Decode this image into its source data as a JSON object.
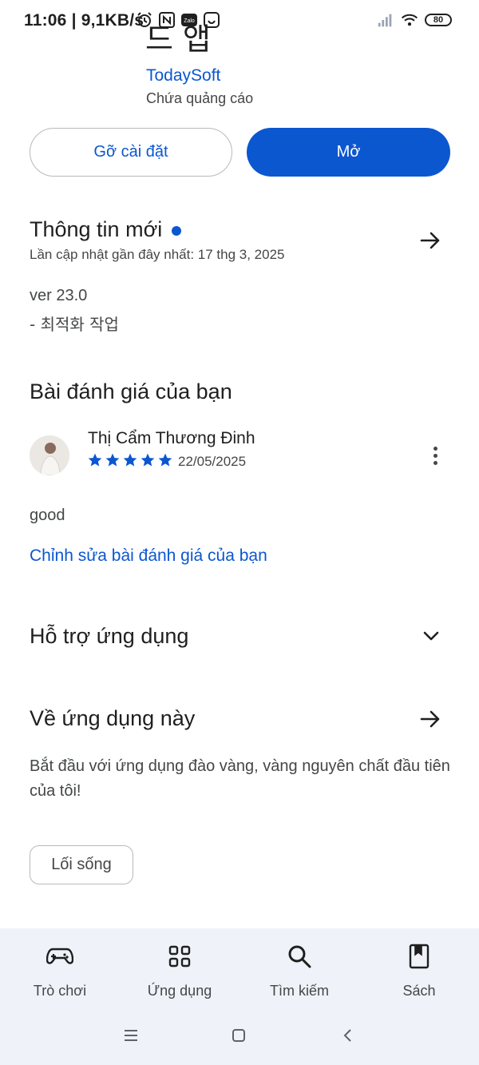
{
  "status_bar": {
    "time_speed": "11:06 | 9,1KB/s",
    "battery": "80",
    "icons": [
      "alarm-icon",
      "nfc-icon",
      "zalo-icon",
      "smiley-app-icon",
      "signal-icon",
      "wifi-icon",
      "battery-icon"
    ],
    "zalo_text": "Zalo"
  },
  "app": {
    "name_partial": "드 앱",
    "developer": "TodaySoft",
    "ads_note": "Chứa quảng cáo"
  },
  "actions": {
    "uninstall_label": "Gỡ cài đặt",
    "open_label": "Mở"
  },
  "whats_new": {
    "title": "Thông tin mới",
    "updated": "Lần cập nhật gần đây nhất: 17 thg 3, 2025",
    "version": "ver 23.0",
    "notes": "- 최적화 작업"
  },
  "your_review": {
    "title": "Bài đánh giá của bạn",
    "reviewer": "Thị Cẩm Thương Đinh",
    "rating": 5,
    "date": "22/05/2025",
    "text": "good",
    "edit_link": "Chỉnh sửa bài đánh giá của bạn"
  },
  "support": {
    "title": "Hỗ trợ ứng dụng"
  },
  "about": {
    "title": "Về ứng dụng này",
    "description": "Bắt đầu với ứng dụng đào vàng, vàng nguyên chất đầu tiên của tôi!",
    "chip": "Lối sống"
  },
  "bottom_nav": {
    "items": [
      {
        "label": "Trò chơi",
        "icon": "gamepad-icon"
      },
      {
        "label": "Ứng dụng",
        "icon": "apps-grid-icon"
      },
      {
        "label": "Tìm kiếm",
        "icon": "search-icon"
      },
      {
        "label": "Sách",
        "icon": "book-icon"
      }
    ]
  },
  "colors": {
    "accent": "#0b57d0",
    "text": "#1f1f1f",
    "muted": "#444746",
    "nav_bg": "#eff3f9"
  }
}
